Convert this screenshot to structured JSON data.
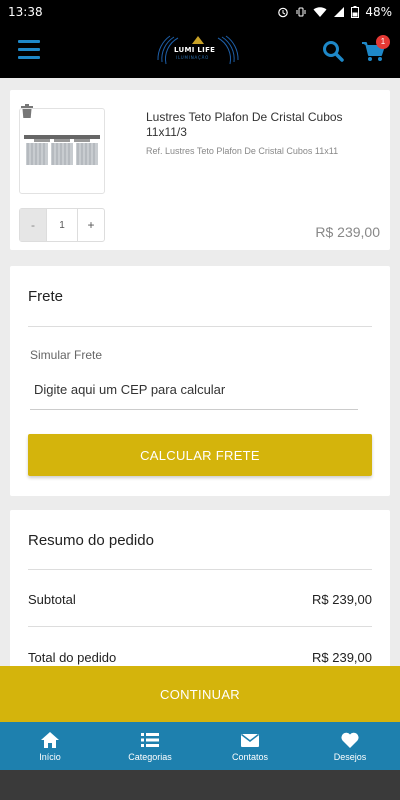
{
  "status_bar": {
    "time": "13:38",
    "battery": "48%"
  },
  "header": {
    "logo_text": "LUMI LIFE",
    "logo_subtext": "ILUMINAÇÃO",
    "cart_count": "1"
  },
  "product": {
    "title": "Lustres Teto Plafon De Cristal Cubos 11x11/3",
    "ref": "Ref. Lustres Teto Plafon De Cristal Cubos 11x11",
    "quantity": "1",
    "minus_label": "-",
    "plus_label": "+",
    "price": "R$ 239,00"
  },
  "frete": {
    "title": "Frete",
    "simulate_label": "Simular Frete",
    "cep_placeholder": "Digite aqui um CEP para calcular",
    "button_label": "CALCULAR FRETE"
  },
  "resumo": {
    "title": "Resumo do pedido",
    "subtotal_label": "Subtotal",
    "subtotal_value": "R$ 239,00",
    "total_label": "Total do pedido",
    "total_value": "R$ 239,00"
  },
  "continue_label": "CONTINUAR",
  "bottom_nav": {
    "items": [
      {
        "label": "Início",
        "icon": "home-icon"
      },
      {
        "label": "Categorias",
        "icon": "list-icon"
      },
      {
        "label": "Contatos",
        "icon": "mail-icon"
      },
      {
        "label": "Desejos",
        "icon": "heart-icon"
      }
    ]
  },
  "colors": {
    "accent_yellow": "#d4b40c",
    "nav_blue": "#1e80ae",
    "icon_blue": "#1e88c8",
    "badge_red": "#e53935"
  }
}
